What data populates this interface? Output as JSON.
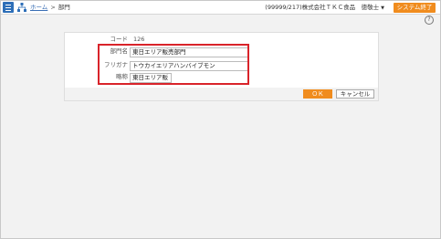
{
  "header": {
    "breadcrumb_home": "ホーム",
    "breadcrumb_sep": ">",
    "breadcrumb_current": "部門",
    "company": "(99999/217)株式会社ＴＫＣ食品　徳敬士",
    "caret": "▼",
    "system_exit": "システム終了",
    "help": "?"
  },
  "form": {
    "code_label": "コード",
    "code_value": "126",
    "name_label": "部門名",
    "name_value": "東日エリア販売部門",
    "kana_label": "フリガナ",
    "kana_value": "トウカイエリアハンバイブモン",
    "abbr_label": "略称",
    "abbr_value": "東日エリア販"
  },
  "buttons": {
    "ok": "ＯＫ",
    "cancel": "キャンセル"
  },
  "colors": {
    "accent_orange": "#f08c1e",
    "menu_blue": "#2e6fb8",
    "highlight_red": "#d9232a"
  }
}
